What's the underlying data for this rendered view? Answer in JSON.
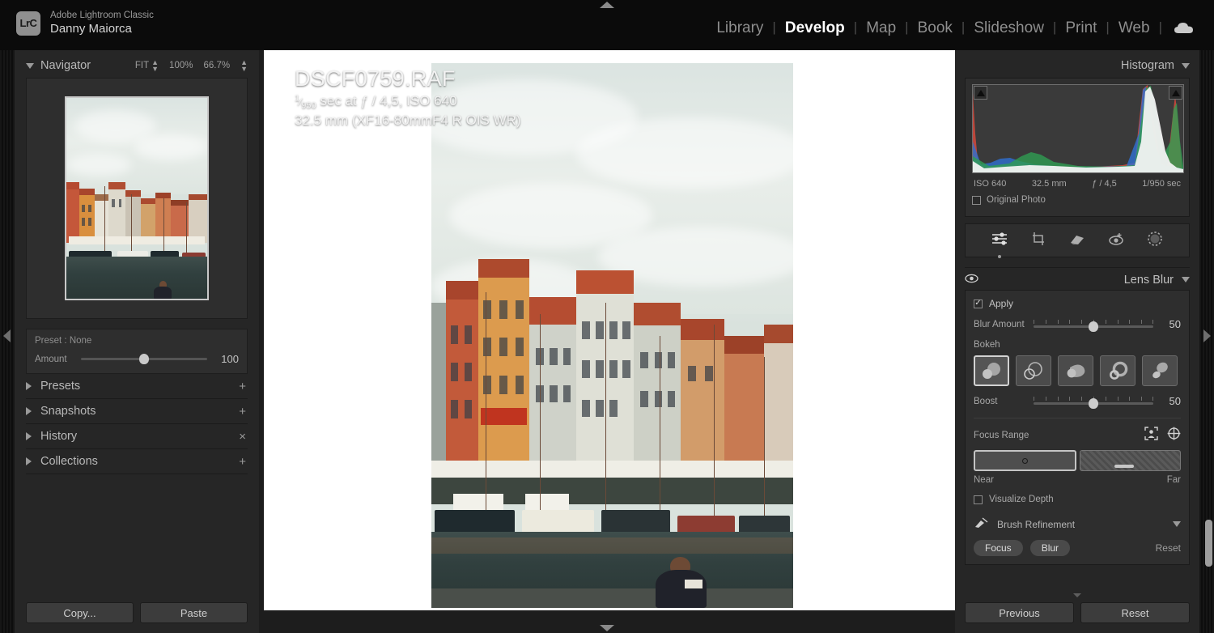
{
  "app": {
    "name": "Adobe Lightroom Classic",
    "user": "Danny Maiorca",
    "logo_text": "LrC"
  },
  "modules": [
    {
      "label": "Library",
      "active": false
    },
    {
      "label": "Develop",
      "active": true
    },
    {
      "label": "Map",
      "active": false
    },
    {
      "label": "Book",
      "active": false
    },
    {
      "label": "Slideshow",
      "active": false
    },
    {
      "label": "Print",
      "active": false
    },
    {
      "label": "Web",
      "active": false
    }
  ],
  "module_separator": "|",
  "cloud_icon": "cloud-icon",
  "left_panel": {
    "navigator": {
      "title": "Navigator",
      "zoom_fit": "FIT",
      "zoom_100": "100%",
      "zoom_custom": "66.7%"
    },
    "preset_strip": {
      "preset_label": "Preset : None",
      "amount_label": "Amount",
      "amount_value": "100",
      "amount_percent": 50
    },
    "sections": [
      {
        "label": "Presets",
        "action": "+"
      },
      {
        "label": "Snapshots",
        "action": "+"
      },
      {
        "label": "History",
        "action": "×"
      },
      {
        "label": "Collections",
        "action": "+"
      }
    ],
    "buttons": [
      {
        "label": "Copy..."
      },
      {
        "label": "Paste"
      }
    ]
  },
  "center": {
    "overlay": {
      "filename": "DSCF0759.RAF",
      "shutter_numerator": "1",
      "shutter_denominator": "950",
      "exposure_line": "sec at ƒ / 4,5, ISO 640",
      "lens_line": "32.5 mm (XF16-80mmF4 R OIS WR)"
    }
  },
  "right_panel": {
    "histogram": {
      "title": "Histogram",
      "iso": "ISO 640",
      "focal": "32.5 mm",
      "aperture": "ƒ / 4,5",
      "shutter": "1/950 sec",
      "original_photo_label": "Original Photo",
      "original_photo_checked": false
    },
    "tools": [
      {
        "name": "basic-edit-icon",
        "active": true
      },
      {
        "name": "crop-icon",
        "active": false
      },
      {
        "name": "spot-removal-icon",
        "active": false
      },
      {
        "name": "red-eye-icon",
        "active": false
      },
      {
        "name": "masking-icon",
        "active": false
      }
    ],
    "lens_blur": {
      "title": "Lens Blur",
      "visibility_icon": "eye-icon",
      "apply_label": "Apply",
      "apply_checked": true,
      "blur_amount_label": "Blur Amount",
      "blur_amount_value": "50",
      "blur_amount_percent": 50,
      "bokeh_label": "Bokeh",
      "bokeh_shapes": [
        {
          "name": "bokeh-circle",
          "selected": true
        },
        {
          "name": "bokeh-rings",
          "selected": false
        },
        {
          "name": "bokeh-bubble",
          "selected": false
        },
        {
          "name": "bokeh-donut",
          "selected": false
        },
        {
          "name": "bokeh-cateye",
          "selected": false
        }
      ],
      "boost_label": "Boost",
      "boost_value": "50",
      "boost_percent": 50,
      "focus_range_label": "Focus Range",
      "focus_near_label": "Near",
      "focus_far_label": "Far",
      "visualize_depth_label": "Visualize Depth",
      "visualize_depth_checked": false,
      "brush_refinement_label": "Brush Refinement",
      "focus_pill": "Focus",
      "blur_pill": "Blur",
      "reset_link": "Reset"
    },
    "buttons": [
      {
        "label": "Previous"
      },
      {
        "label": "Reset"
      }
    ]
  },
  "colors": {
    "panel_bg": "#262626",
    "canvas_bg": "#1d1d1d",
    "accent_text": "#ffffff",
    "muted_text": "#9a9a9a"
  }
}
